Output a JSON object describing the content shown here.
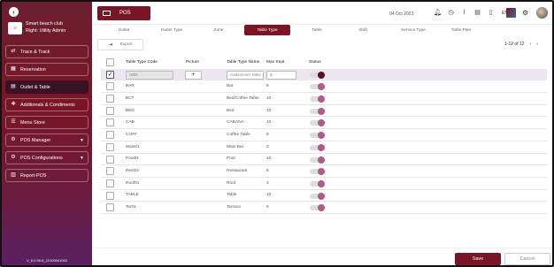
{
  "sidebar": {
    "back_icon": "chevron-left-icon",
    "club_name": "Smart beach club",
    "role": "Right: Utility Admin",
    "items": [
      {
        "label": "Trace & Track",
        "icon": "trace-icon",
        "glyph": "⇄",
        "chevron": false,
        "active": false
      },
      {
        "label": "Reservation",
        "icon": "calendar-icon",
        "glyph": "▦",
        "chevron": false,
        "active": false
      },
      {
        "label": "Outlet & Table",
        "icon": "outlet-icon",
        "glyph": "▤",
        "chevron": false,
        "active": true
      },
      {
        "label": "Additionals & Condiments",
        "icon": "additionals-icon",
        "glyph": "✚",
        "chevron": false,
        "active": false
      },
      {
        "label": "Menu Store",
        "icon": "menu-icon",
        "glyph": "☰",
        "chevron": false,
        "active": false
      },
      {
        "label": "POS Manager",
        "icon": "manager-icon",
        "glyph": "⚙",
        "chevron": true,
        "active": false
      },
      {
        "label": "POS Configurations",
        "icon": "config-icon",
        "glyph": "⚙",
        "chevron": true,
        "active": false
      },
      {
        "label": "Report-POS",
        "icon": "report-icon",
        "glyph": "▥",
        "chevron": false,
        "active": false
      }
    ],
    "version": "V_5.0.39.8_22100041002"
  },
  "header": {
    "module": "POS",
    "date": "04 Oct 2023",
    "lang": "EN"
  },
  "tabs": [
    {
      "label": "Outlet",
      "active": false
    },
    {
      "label": "Outlet Type",
      "active": false
    },
    {
      "label": "Zone",
      "active": false
    },
    {
      "label": "Table Type",
      "active": true
    },
    {
      "label": "Table",
      "active": false
    },
    {
      "label": "Shift",
      "active": false
    },
    {
      "label": "Service Type",
      "active": false
    },
    {
      "label": "Table Plan",
      "active": false
    }
  ],
  "toolbar": {
    "export_label": "Export",
    "pager_text": "1-12 of 12",
    "prev": "‹",
    "next": "›"
  },
  "table": {
    "columns": [
      "Table Type Code",
      "Picture",
      "Table Type Name",
      "Max Seat",
      "Status"
    ],
    "add_row": {
      "code": "ADD",
      "name_placeholder": "Additionnel Table",
      "max_seat": "3",
      "plus": "+"
    },
    "rows": [
      {
        "code": "BAR",
        "name": "Bar",
        "seat": "8"
      },
      {
        "code": "BCT",
        "name": "Bed/Coffee Table",
        "seat": "10"
      },
      {
        "code": "BED",
        "name": "Bed",
        "seat": "10"
      },
      {
        "code": "CAB",
        "name": "CABANA",
        "seat": "10"
      },
      {
        "code": "COFF",
        "name": "Coffee Table",
        "seat": "8"
      },
      {
        "code": "Main01",
        "name": "Main Bar",
        "seat": "3"
      },
      {
        "code": "Pool01",
        "name": "Pool",
        "seat": "10"
      },
      {
        "code": "Rest01",
        "name": "Restaurant",
        "seat": "8"
      },
      {
        "code": "Roof01",
        "name": "Roof",
        "seat": "3"
      },
      {
        "code": "TABLE",
        "name": "Table",
        "seat": "10"
      },
      {
        "code": "Ter01",
        "name": "Terrace",
        "seat": "8"
      }
    ]
  },
  "footer": {
    "save_label": "Save",
    "cancel_label": "Cancel"
  },
  "colors": {
    "accent": "#7a1526",
    "toggle_knob": "#b05a88"
  }
}
